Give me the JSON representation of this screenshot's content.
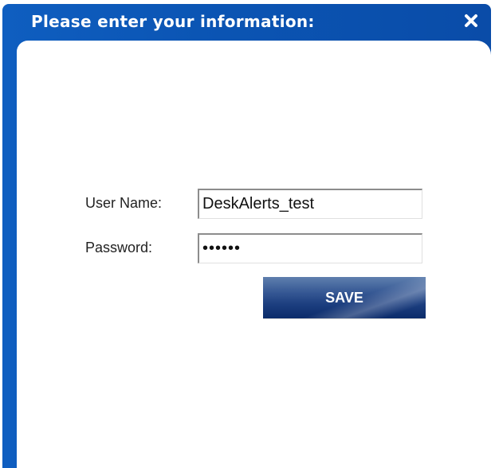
{
  "dialog": {
    "title": "Please enter your information:",
    "close_icon": "close-icon"
  },
  "form": {
    "username_label": "User Name:",
    "username_value": "DeskAlerts_test",
    "password_label": "Password:",
    "password_value": "••••••",
    "save_label": "SAVE"
  },
  "colors": {
    "titlebar": "#0b55b4",
    "button": "#1d3f80",
    "background": "#ffffff"
  }
}
